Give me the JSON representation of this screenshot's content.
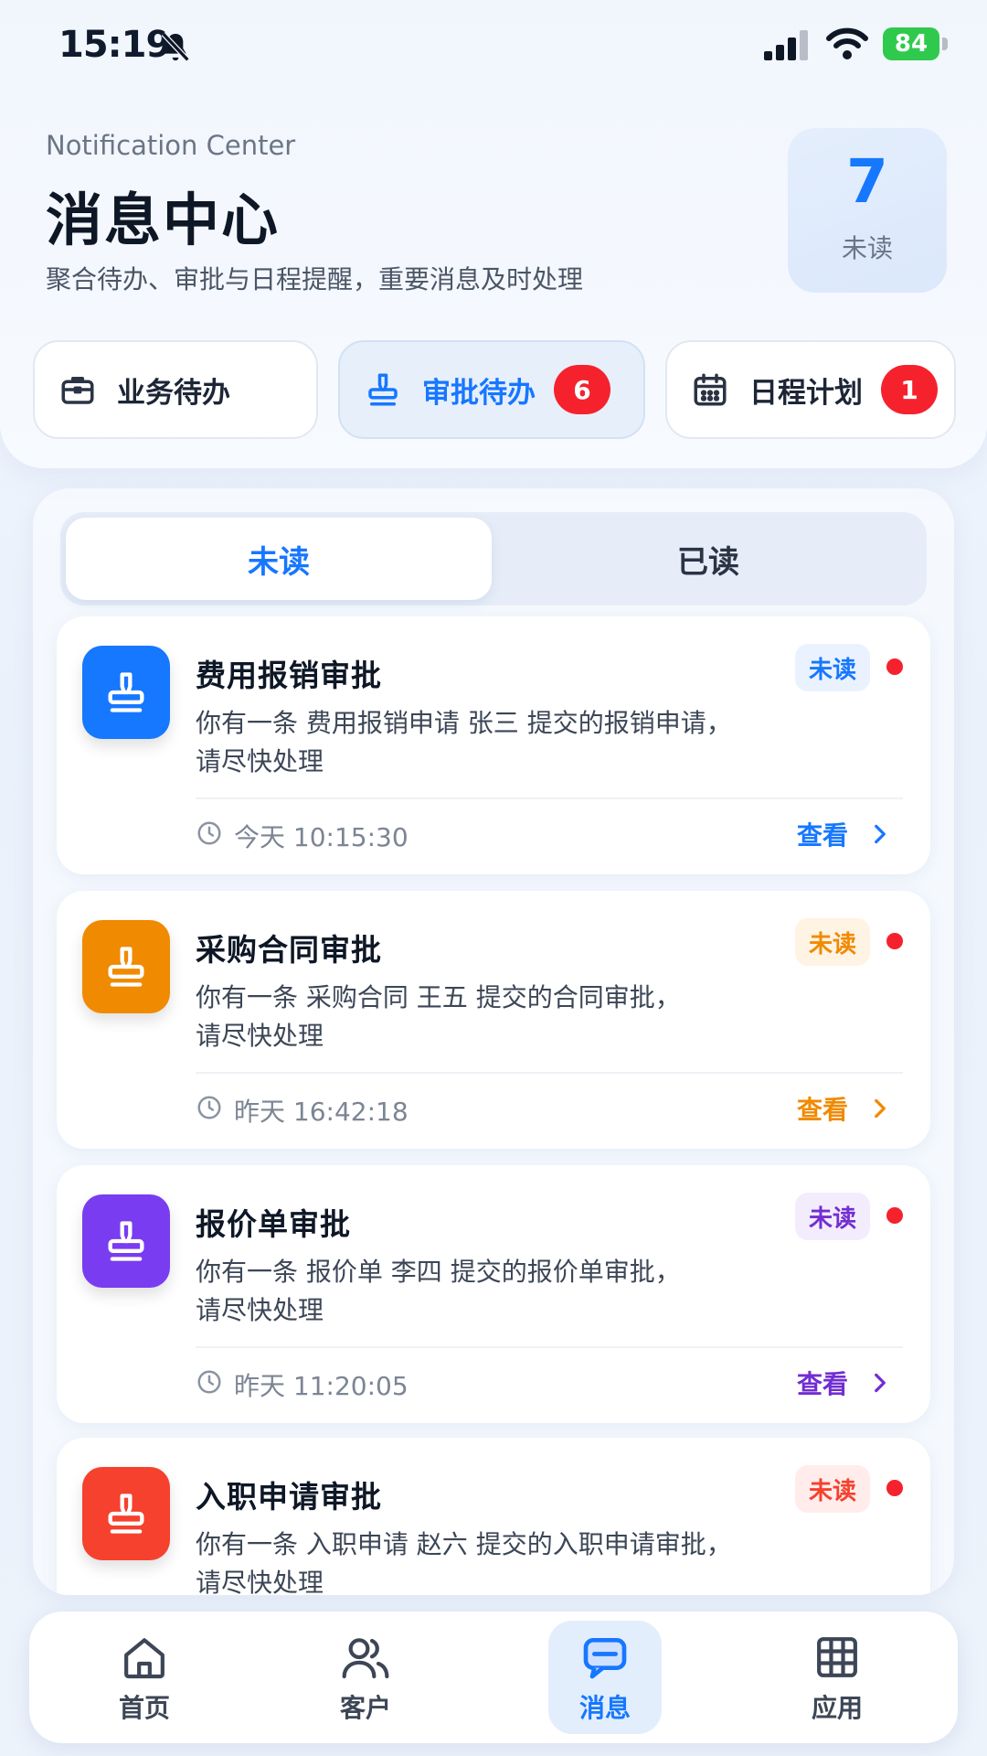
{
  "status_bar": {
    "time": "15:19",
    "battery": "84",
    "icons": [
      "bell-slash-icon",
      "signal-icon",
      "wifi-icon",
      "battery-charging-icon"
    ]
  },
  "header": {
    "subtitle_en": "Notification Center",
    "title": "消息中心",
    "description": "聚合待办、审批与日程提醒，重要消息及时处理",
    "unread_count": "7",
    "unread_label": "未读"
  },
  "categories": [
    {
      "label": "业务待办",
      "icon": "briefcase-icon",
      "badge": ""
    },
    {
      "label": "审批待办",
      "icon": "stamp-icon",
      "badge": "6"
    },
    {
      "label": "日程计划",
      "icon": "calendar-icon",
      "badge": "1"
    }
  ],
  "tabs": {
    "unread": "未读",
    "read": "已读"
  },
  "messages": [
    {
      "title": "费用报销审批",
      "body_line1": "你有一条 费用报销申请 张三 提交的报销申请，",
      "body_line2": "请尽快处理",
      "tag": "未读",
      "time": "今天 10:15:30",
      "action": "查看",
      "accent": "#1677ff",
      "tile_color": "#1677ff",
      "tag_bg": "#eaf2ff"
    },
    {
      "title": "采购合同审批",
      "body_line1": "你有一条 采购合同 王五 提交的合同审批，",
      "body_line2": "请尽快处理",
      "tag": "未读",
      "time": "昨天 16:42:18",
      "action": "查看",
      "accent": "#f08a00",
      "tile_color": "#f08a00",
      "tag_bg": "#fff3e4"
    },
    {
      "title": "报价单审批",
      "body_line1": "你有一条 报价单 李四 提交的报价单审批，",
      "body_line2": "请尽快处理",
      "tag": "未读",
      "time": "昨天 11:20:05",
      "action": "查看",
      "accent": "#722ed1",
      "tile_color": "#7a3cf0",
      "tag_bg": "#f3ecfd"
    },
    {
      "title": "入职申请审批",
      "body_line1": "你有一条 入职申请 赵六 提交的入职申请审批，",
      "body_line2": "请尽快处理",
      "tag": "未读",
      "time": "",
      "action": "",
      "accent": "#f5412d",
      "tile_color": "#f5412d",
      "tag_bg": "#ffeceb"
    }
  ],
  "bottom_nav": [
    {
      "label": "首页",
      "icon": "home-icon"
    },
    {
      "label": "客户",
      "icon": "users-icon"
    },
    {
      "label": "消息",
      "icon": "chat-icon",
      "active": true
    },
    {
      "label": "应用",
      "icon": "grid-icon"
    }
  ],
  "colors": {
    "primary": "#1677ff",
    "badge_red": "#f5222d"
  }
}
